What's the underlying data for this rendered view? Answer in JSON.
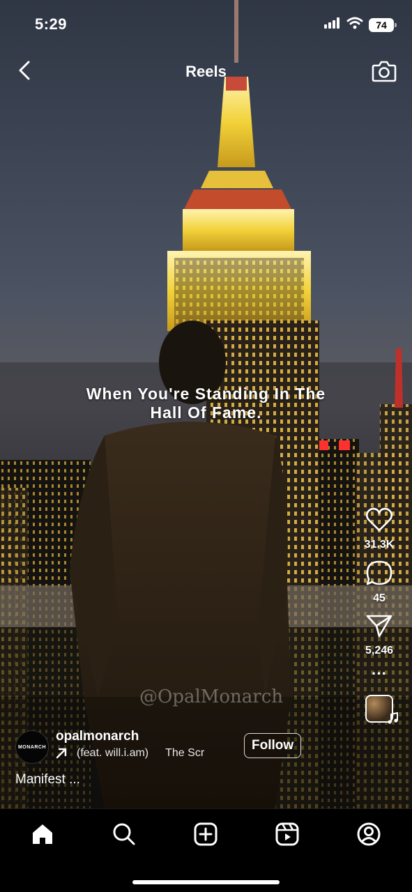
{
  "status_bar": {
    "time": "5:29",
    "battery": "74",
    "icons": [
      "cellular-signal-icon",
      "wifi-icon",
      "battery-icon"
    ]
  },
  "header": {
    "title": "Reels",
    "icons": [
      "back-arrow-icon",
      "camera-icon"
    ]
  },
  "video": {
    "caption_line1": "When You're Standing In The",
    "caption_line2": "Hall Of Fame.",
    "watermark": "@OpalMonarch"
  },
  "actions": {
    "likes": "31.3K",
    "comments": "45",
    "shares": "5,246",
    "more": "···",
    "icons": [
      "heart-icon",
      "comment-icon",
      "share-icon",
      "more-icon",
      "music-note-icon"
    ]
  },
  "account": {
    "username": "opalmonarch",
    "avatar_text": "MONARCH",
    "audio_track": "(feat. will.i.am)",
    "audio_track_next": "The Scr",
    "follow_label": "Follow",
    "description": "Manifest ..."
  },
  "bottom_nav": {
    "items": [
      "home-icon",
      "search-icon",
      "create-icon",
      "reels-icon",
      "profile-icon"
    ]
  },
  "colors": {
    "background": "#000000",
    "text": "#ffffff",
    "building_glow": "#f3d64a"
  }
}
